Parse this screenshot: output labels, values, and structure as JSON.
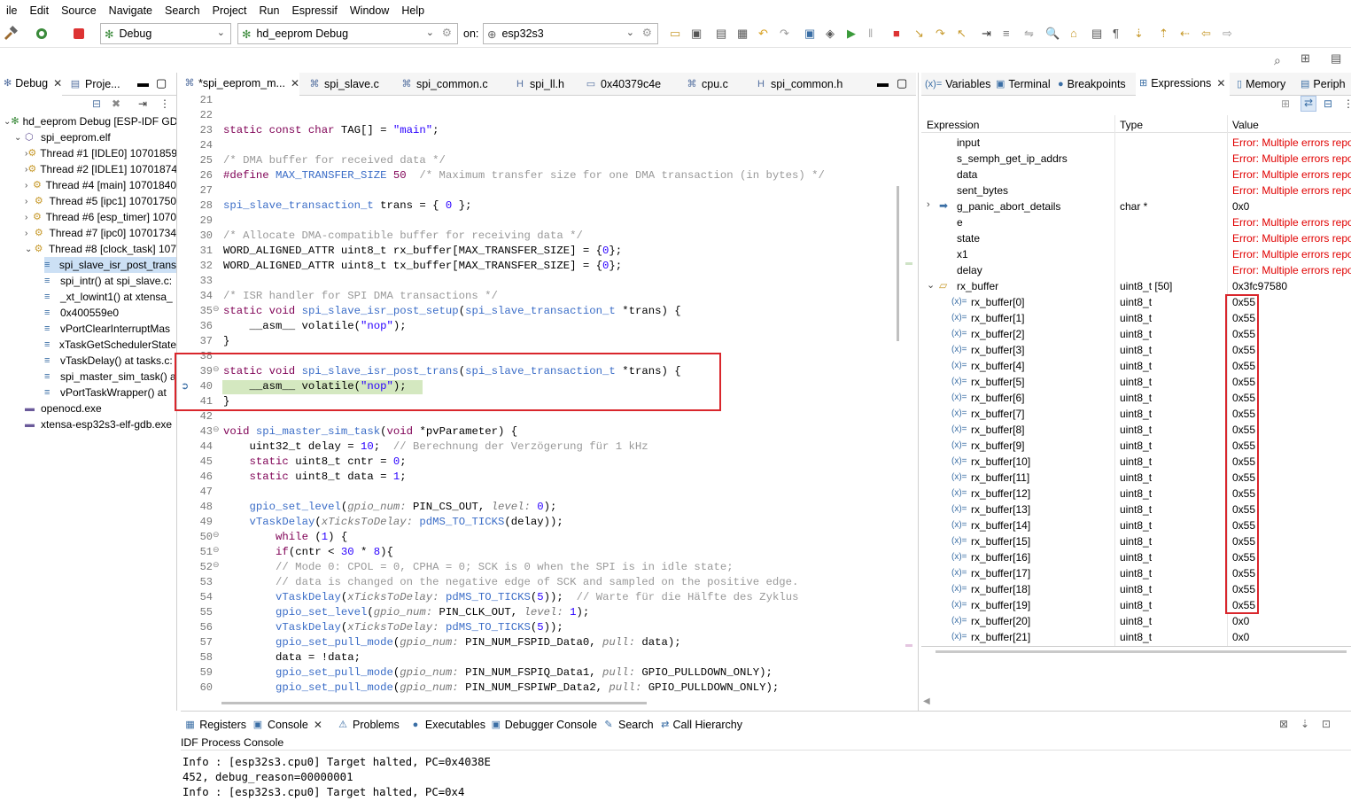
{
  "menu": [
    "ile",
    "Edit",
    "Source",
    "Navigate",
    "Search",
    "Project",
    "Run",
    "Espressif",
    "Window",
    "Help"
  ],
  "toolbar": {
    "mode": "Debug",
    "config": "hd_eeprom Debug",
    "on_label": "on:",
    "target": "esp32s3"
  },
  "debug_panel": {
    "tabs": [
      "Debug",
      "Proje..."
    ],
    "tree": [
      {
        "label": "hd_eeprom Debug [ESP-IDF GDE",
        "level": 0,
        "tw": "⌄"
      },
      {
        "label": "spi_eeprom.elf",
        "level": 1,
        "tw": "⌄"
      },
      {
        "label": "Thread #1 [IDLE0] 10701859",
        "level": 2,
        "tw": "›"
      },
      {
        "label": "Thread #2 [IDLE1] 10701874",
        "level": 2,
        "tw": "›"
      },
      {
        "label": "Thread #4 [main] 10701840",
        "level": 2,
        "tw": "›"
      },
      {
        "label": "Thread #5 [ipc1] 10701750",
        "level": 2,
        "tw": "›"
      },
      {
        "label": "Thread #6 [esp_timer] 1070",
        "level": 2,
        "tw": "›"
      },
      {
        "label": "Thread #7 [ipc0] 10701734",
        "level": 2,
        "tw": "›"
      },
      {
        "label": "Thread #8 [clock_task] 107",
        "level": 2,
        "tw": "⌄"
      },
      {
        "label": "spi_slave_isr_post_trans",
        "level": 3,
        "tw": "",
        "selected": true
      },
      {
        "label": "spi_intr() at spi_slave.c:",
        "level": 3,
        "tw": ""
      },
      {
        "label": "_xt_lowint1() at xtensa_",
        "level": 3,
        "tw": ""
      },
      {
        "label": "0x400559e0",
        "level": 3,
        "tw": ""
      },
      {
        "label": "vPortClearInterruptMas",
        "level": 3,
        "tw": ""
      },
      {
        "label": "xTaskGetSchedulerState",
        "level": 3,
        "tw": ""
      },
      {
        "label": "vTaskDelay() at tasks.c:",
        "level": 3,
        "tw": ""
      },
      {
        "label": "spi_master_sim_task() a",
        "level": 3,
        "tw": ""
      },
      {
        "label": "vPortTaskWrapper() at",
        "level": 3,
        "tw": ""
      },
      {
        "label": "openocd.exe",
        "level": 1,
        "tw": ""
      },
      {
        "label": "xtensa-esp32s3-elf-gdb.exe",
        "level": 1,
        "tw": ""
      }
    ]
  },
  "editor": {
    "tabs": [
      "*spi_eeprom_m...",
      "spi_slave.c",
      "spi_common.c",
      "spi_ll.h",
      "0x40379c4e",
      "cpu.c",
      "spi_common.h"
    ]
  },
  "code_lines": [
    {
      "n": "21",
      "html": ""
    },
    {
      "n": "22",
      "html": ""
    },
    {
      "n": "23",
      "html": "<span class='kw'>static const char</span> TAG[] = <span class='st'>\"main\"</span>;"
    },
    {
      "n": "24",
      "html": ""
    },
    {
      "n": "25",
      "html": "<span class='cmx'>/* DMA buffer for received data */</span>"
    },
    {
      "n": "26",
      "html": "<span class='kw'>#define</span> <span class='mc'>MAX_TRANSFER_SIZE</span> <span class='kw'>50</span>  <span class='cmx'>/* Maximum transfer size for one DMA transaction (in bytes) */</span>"
    },
    {
      "n": "27",
      "html": ""
    },
    {
      "n": "28",
      "html": "<span class='ty'>spi_slave_transaction_t</span> trans = { <span class='st'>0</span> };"
    },
    {
      "n": "29",
      "html": ""
    },
    {
      "n": "30",
      "html": "<span class='cmx'>/* Allocate DMA-compatible buffer for receiving data */</span>"
    },
    {
      "n": "31",
      "html": "WORD_ALIGNED_ATTR uint8_t rx_buffer[MAX_TRANSFER_SIZE] = {<span class='st'>0</span>};"
    },
    {
      "n": "32",
      "html": "WORD_ALIGNED_ATTR uint8_t tx_buffer[MAX_TRANSFER_SIZE] = {<span class='st'>0</span>};"
    },
    {
      "n": "33",
      "html": ""
    },
    {
      "n": "34",
      "html": "<span class='cmx'>/* ISR handler for SPI DMA transactions */</span>"
    },
    {
      "n": "35",
      "html": "<span class='kw'>static void</span> <span class='fn'>spi_slave_isr_post_setup</span>(<span class='ty'>spi_slave_transaction_t</span> *trans) {"
    },
    {
      "n": "36",
      "html": "    __asm__ volatile(<span class='st'>\"nop\"</span>);"
    },
    {
      "n": "37",
      "html": "}"
    },
    {
      "n": "38",
      "html": ""
    },
    {
      "n": "39",
      "html": "<span class='kw'>static void</span> <span class='fn'>spi_slave_isr_post_trans</span>(<span class='ty'>spi_slave_transaction_t</span> *trans) {"
    },
    {
      "n": "40",
      "html": "    __asm__ volatile(<span class='st'>\"nop\"</span>);"
    },
    {
      "n": "41",
      "html": "}"
    },
    {
      "n": "42",
      "html": ""
    },
    {
      "n": "43",
      "html": "<span class='kw'>void</span> <span class='fn'>spi_master_sim_task</span>(<span class='kw'>void</span> *pvParameter) {"
    },
    {
      "n": "44",
      "html": "    uint32_t delay = <span class='st'>10</span>;  <span class='cmx'>// Berechnung der Verzögerung für 1 kHz</span>"
    },
    {
      "n": "45",
      "html": "    <span class='kw'>static</span> uint8_t cntr = <span class='st'>0</span>;"
    },
    {
      "n": "46",
      "html": "    <span class='kw'>static</span> uint8_t data = <span class='st'>1</span>;"
    },
    {
      "n": "47",
      "html": ""
    },
    {
      "n": "48",
      "html": "    <span class='fn'>gpio_set_level</span>(<span class='pm'>gpio_num:</span> PIN_CS_OUT, <span class='pm'>level:</span> <span class='st'>0</span>);"
    },
    {
      "n": "49",
      "html": "    <span class='fn'>vTaskDelay</span>(<span class='pm'>xTicksToDelay:</span> <span class='fn'>pdMS_TO_TICKS</span>(delay));"
    },
    {
      "n": "50",
      "html": "        <span class='kw'>while</span> (<span class='st'>1</span>) {"
    },
    {
      "n": "51",
      "html": "        <span class='kw'>if</span>(cntr < <span class='st'>30</span> * <span class='st'>8</span>){"
    },
    {
      "n": "52",
      "html": "        <span class='cmx'>// Mode 0: CPOL = 0, CPHA = 0; SCK is 0 when the SPI is in idle state;</span>"
    },
    {
      "n": "53",
      "html": "        <span class='cmx'>// data is changed on the negative edge of SCK and sampled on the positive edge.</span>"
    },
    {
      "n": "54",
      "html": "        <span class='fn'>vTaskDelay</span>(<span class='pm'>xTicksToDelay:</span> <span class='fn'>pdMS_TO_TICKS</span>(<span class='st'>5</span>));  <span class='cmx'>// Warte für die Hälfte des Zyklus</span>"
    },
    {
      "n": "55",
      "html": "        <span class='fn'>gpio_set_level</span>(<span class='pm'>gpio_num:</span> PIN_CLK_OUT, <span class='pm'>level:</span> <span class='st'>1</span>);"
    },
    {
      "n": "56",
      "html": "        <span class='fn'>vTaskDelay</span>(<span class='pm'>xTicksToDelay:</span> <span class='fn'>pdMS_TO_TICKS</span>(<span class='st'>5</span>));"
    },
    {
      "n": "57",
      "html": "        <span class='fn'>gpio_set_pull_mode</span>(<span class='pm'>gpio_num:</span> PIN_NUM_FSPID_Data0, <span class='pm'>pull:</span> data);"
    },
    {
      "n": "58",
      "html": "        data = !data;"
    },
    {
      "n": "59",
      "html": "        <span class='fn'>gpio_set_pull_mode</span>(<span class='pm'>gpio_num:</span> PIN_NUM_FSPIQ_Data1, <span class='pm'>pull:</span> GPIO_PULLDOWN_ONLY);"
    },
    {
      "n": "60",
      "html": "        <span class='fn'>gpio_set_pull_mode</span>(<span class='pm'>gpio_num:</span> PIN_NUM_FSPIWP_Data2, <span class='pm'>pull:</span> GPIO_PULLDOWN_ONLY);"
    }
  ],
  "right_panel": {
    "tabs": [
      "Variables",
      "Terminal",
      "Breakpoints",
      "Expressions",
      "Memory",
      "Periph"
    ],
    "headers": [
      "Expression",
      "Type",
      "Value"
    ],
    "rows": [
      {
        "name": "input",
        "type": "",
        "value": "Error: Multiple errors repo",
        "error": true,
        "indent": 0
      },
      {
        "name": "s_semph_get_ip_addrs",
        "type": "",
        "value": "Error: Multiple errors repo",
        "error": true,
        "indent": 0
      },
      {
        "name": "data",
        "type": "",
        "value": "Error: Multiple errors repo",
        "error": true,
        "indent": 0
      },
      {
        "name": "sent_bytes",
        "type": "",
        "value": "Error: Multiple errors repo",
        "error": true,
        "indent": 0
      },
      {
        "name": "g_panic_abort_details",
        "type": "char *",
        "value": "0x0",
        "error": false,
        "indent": 0,
        "tw": "›"
      },
      {
        "name": "e",
        "type": "",
        "value": "Error: Multiple errors repo",
        "error": true,
        "indent": 0
      },
      {
        "name": "state",
        "type": "",
        "value": "Error: Multiple errors repo",
        "error": true,
        "indent": 0
      },
      {
        "name": "x1",
        "type": "",
        "value": "Error: Multiple errors repo",
        "error": true,
        "indent": 0
      },
      {
        "name": "delay",
        "type": "",
        "value": "Error: Multiple errors repo",
        "error": true,
        "indent": 0
      },
      {
        "name": "rx_buffer",
        "type": "uint8_t [50]",
        "value": "0x3fc97580",
        "error": false,
        "indent": 0,
        "tw": "⌄"
      },
      {
        "name": "rx_buffer[0]",
        "type": "uint8_t",
        "value": "0x55",
        "indent": 1
      },
      {
        "name": "rx_buffer[1]",
        "type": "uint8_t",
        "value": "0x55",
        "indent": 1
      },
      {
        "name": "rx_buffer[2]",
        "type": "uint8_t",
        "value": "0x55",
        "indent": 1
      },
      {
        "name": "rx_buffer[3]",
        "type": "uint8_t",
        "value": "0x55",
        "indent": 1
      },
      {
        "name": "rx_buffer[4]",
        "type": "uint8_t",
        "value": "0x55",
        "indent": 1
      },
      {
        "name": "rx_buffer[5]",
        "type": "uint8_t",
        "value": "0x55",
        "indent": 1
      },
      {
        "name": "rx_buffer[6]",
        "type": "uint8_t",
        "value": "0x55",
        "indent": 1
      },
      {
        "name": "rx_buffer[7]",
        "type": "uint8_t",
        "value": "0x55",
        "indent": 1
      },
      {
        "name": "rx_buffer[8]",
        "type": "uint8_t",
        "value": "0x55",
        "indent": 1
      },
      {
        "name": "rx_buffer[9]",
        "type": "uint8_t",
        "value": "0x55",
        "indent": 1
      },
      {
        "name": "rx_buffer[10]",
        "type": "uint8_t",
        "value": "0x55",
        "indent": 1
      },
      {
        "name": "rx_buffer[11]",
        "type": "uint8_t",
        "value": "0x55",
        "indent": 1
      },
      {
        "name": "rx_buffer[12]",
        "type": "uint8_t",
        "value": "0x55",
        "indent": 1
      },
      {
        "name": "rx_buffer[13]",
        "type": "uint8_t",
        "value": "0x55",
        "indent": 1
      },
      {
        "name": "rx_buffer[14]",
        "type": "uint8_t",
        "value": "0x55",
        "indent": 1
      },
      {
        "name": "rx_buffer[15]",
        "type": "uint8_t",
        "value": "0x55",
        "indent": 1
      },
      {
        "name": "rx_buffer[16]",
        "type": "uint8_t",
        "value": "0x55",
        "indent": 1
      },
      {
        "name": "rx_buffer[17]",
        "type": "uint8_t",
        "value": "0x55",
        "indent": 1
      },
      {
        "name": "rx_buffer[18]",
        "type": "uint8_t",
        "value": "0x55",
        "indent": 1
      },
      {
        "name": "rx_buffer[19]",
        "type": "uint8_t",
        "value": "0x55",
        "indent": 1
      },
      {
        "name": "rx_buffer[20]",
        "type": "uint8_t",
        "value": "0x0",
        "indent": 1
      },
      {
        "name": "rx_buffer[21]",
        "type": "uint8_t",
        "value": "0x0",
        "indent": 1
      }
    ]
  },
  "bottom_panel": {
    "tabs": [
      "Registers",
      "Console",
      "Problems",
      "Executables",
      "Debugger Console",
      "Search",
      "Call Hierarchy"
    ],
    "console_title": "IDF Process Console",
    "lines": [
      "Info : [esp32s3.cpu0] Target halted, PC=0x4038E",
      "452, debug_reason=00000001",
      "Info : [esp32s3.cpu0] Target halted, PC=0x4"
    ]
  },
  "colors": {
    "highlight_box": "#d9262c",
    "error_text": "#e00000",
    "current_line": "#d4e8c0",
    "selection": "#cce0f5"
  }
}
